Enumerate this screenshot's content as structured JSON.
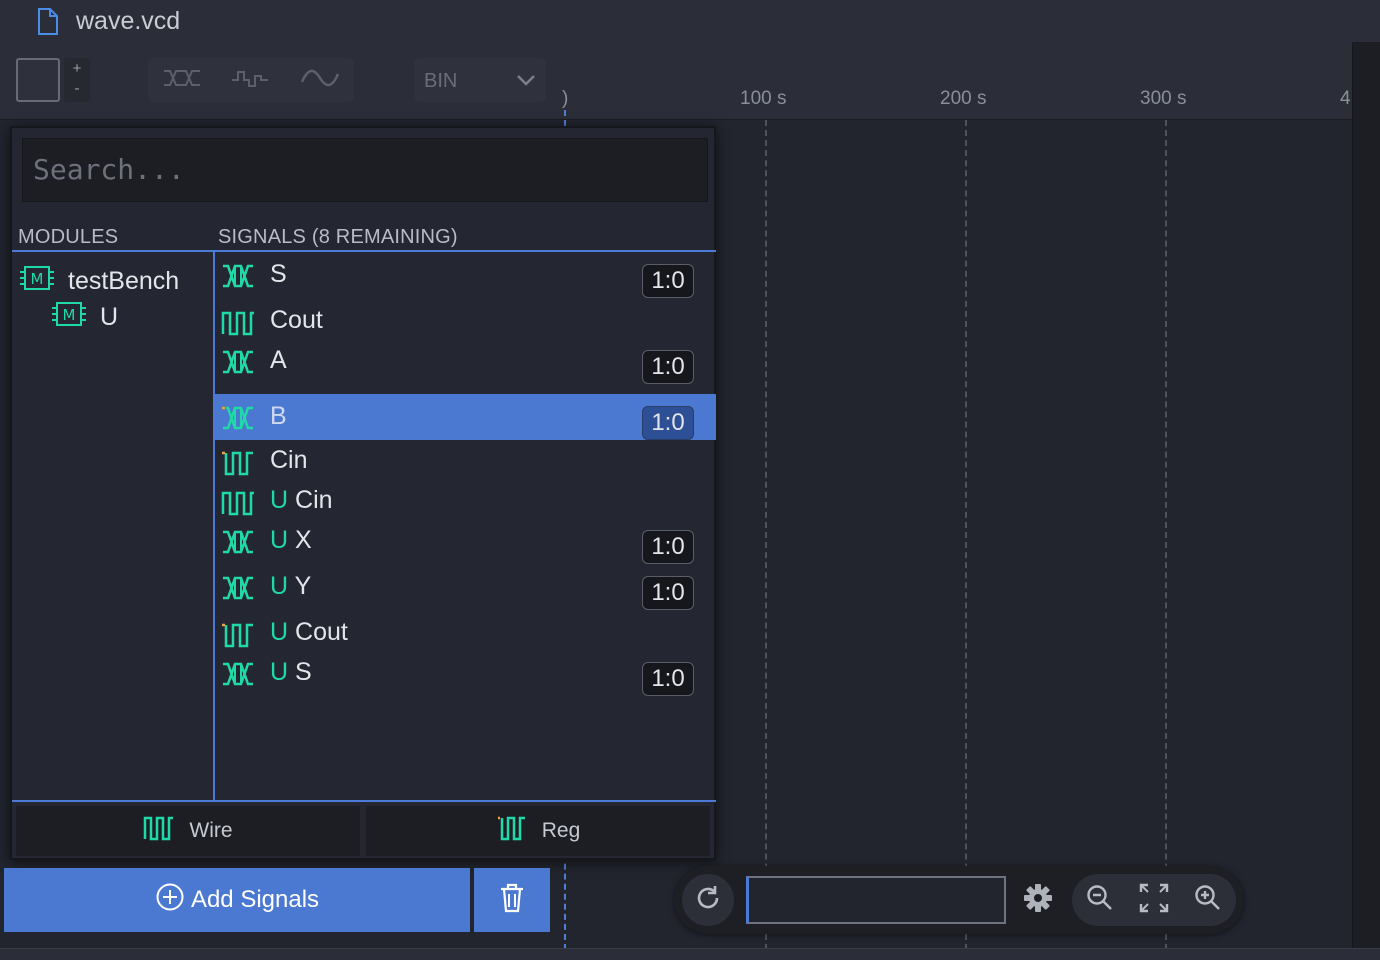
{
  "tab": {
    "filename": "wave.vcd",
    "icon": "file-icon"
  },
  "toolbar": {
    "stepper_plus": "+",
    "stepper_minus": "-",
    "wave_buttons": [
      "bus-wave-icon",
      "step-wave-icon",
      "analog-wave-icon"
    ],
    "base_select": "BIN"
  },
  "ruler": {
    "ticks": [
      ")",
      "100 s",
      "200 s",
      "300 s",
      "4"
    ]
  },
  "popup": {
    "search_placeholder": "Search...",
    "modules_header": "MODULES",
    "signals_header": "SIGNALS (8 REMAINING)",
    "modules": [
      {
        "name": "testBench",
        "icon": "module-icon"
      },
      {
        "name": "U",
        "icon": "module-icon"
      }
    ],
    "signals": [
      {
        "prefix": "",
        "name": "S",
        "type": "bus",
        "range": "1:0",
        "selected": false
      },
      {
        "prefix": "",
        "name": "Cout",
        "type": "wire",
        "range": "",
        "selected": false
      },
      {
        "prefix": "",
        "name": "A",
        "type": "bus",
        "range": "1:0",
        "selected": false
      },
      {
        "prefix": "",
        "name": "B",
        "type": "bus-reg",
        "range": "1:0",
        "selected": true
      },
      {
        "prefix": "",
        "name": "Cin",
        "type": "reg",
        "range": "",
        "selected": false
      },
      {
        "prefix": "U",
        "name": "Cin",
        "type": "wire",
        "range": "",
        "selected": false
      },
      {
        "prefix": "U",
        "name": "X",
        "type": "bus",
        "range": "1:0",
        "selected": false
      },
      {
        "prefix": "U",
        "name": "Y",
        "type": "bus",
        "range": "1:0",
        "selected": false
      },
      {
        "prefix": "U",
        "name": "Cout",
        "type": "reg",
        "range": "",
        "selected": false
      },
      {
        "prefix": "U",
        "name": "S",
        "type": "bus",
        "range": "1:0",
        "selected": false
      }
    ],
    "filters": {
      "wire": "Wire",
      "reg": "Reg"
    }
  },
  "actions": {
    "add_signals": "Add Signals"
  },
  "colors": {
    "accent": "#4b78d0",
    "wire": "#20d9a8",
    "reg": "#f0a23c"
  }
}
